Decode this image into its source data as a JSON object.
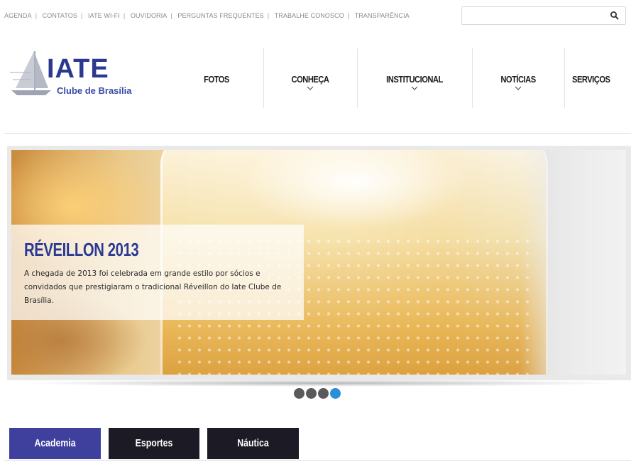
{
  "top_links": [
    "AGENDA",
    "CONTATOS",
    "IATE WI-FI",
    "OUVIDORIA",
    "PERGUNTAS FREQUENTES",
    "TRABALHE CONOSCO",
    "TRANSPARÊNCIA"
  ],
  "top_separator": "|",
  "search": {
    "value": "",
    "placeholder": ""
  },
  "logo": {
    "title": "IATE",
    "subtitle": "Clube de Brasília"
  },
  "nav": [
    {
      "label": "FOTOS",
      "has_dropdown": false
    },
    {
      "label": "CONHEÇA",
      "has_dropdown": true
    },
    {
      "label": "INSTITUCIONAL",
      "has_dropdown": true
    },
    {
      "label": "NOTÍCIAS",
      "has_dropdown": true
    },
    {
      "label": "SERVIÇOS",
      "has_dropdown": false
    }
  ],
  "slide": {
    "title": "RÉVEILLON 2013",
    "text": "A chegada de 2013 foi celebrada em grande estilo por sócios e convidados que prestigiaram o tradicional Réveillon do Iate Clube de Brasília."
  },
  "slider_dots": {
    "count": 4,
    "active_index": 3
  },
  "tabs": [
    {
      "label": "Academia",
      "color": "#3f3f9e"
    },
    {
      "label": "Esportes",
      "color": "#1c1a24"
    },
    {
      "label": "Náutica",
      "color": "#1c1a24"
    }
  ],
  "colors": {
    "brand": "#2b3a8f",
    "dot_active": "#2a8fd8",
    "dot_inactive": "#5a5a5a"
  }
}
